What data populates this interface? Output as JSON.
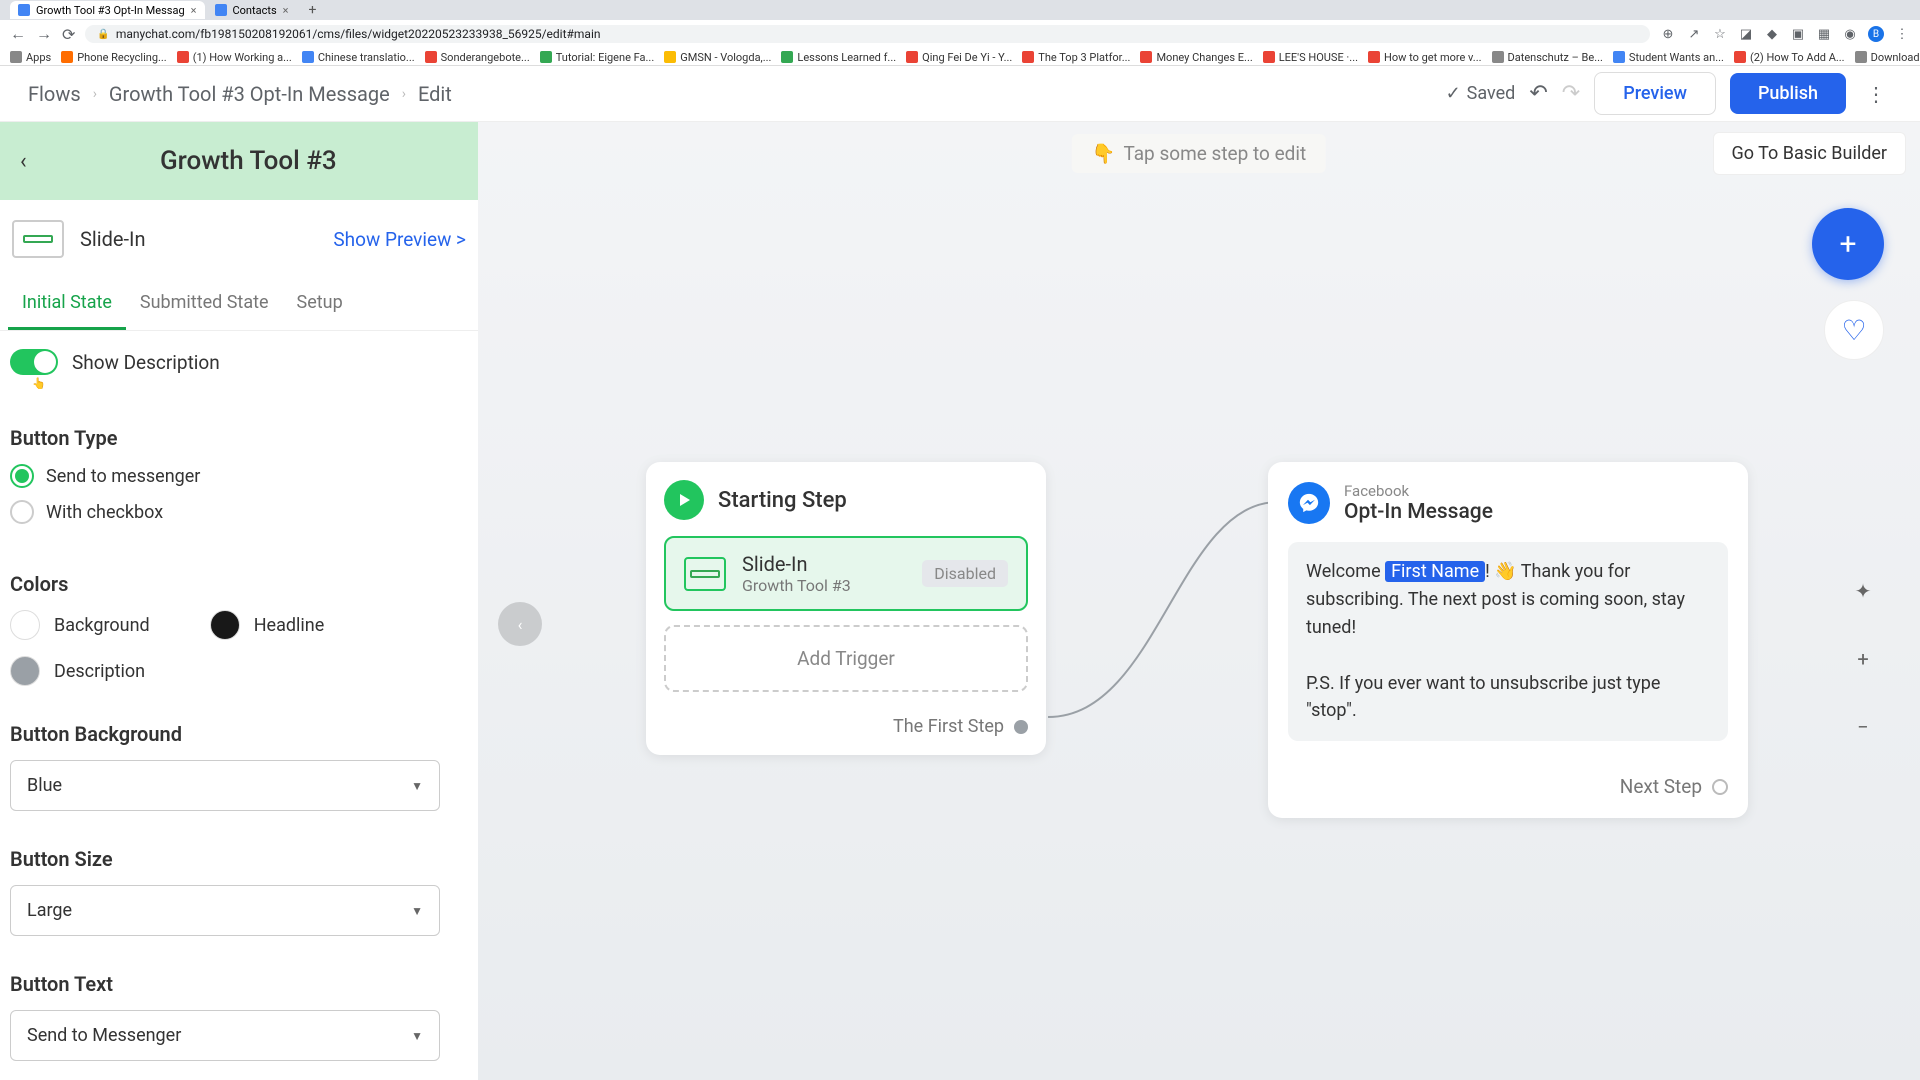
{
  "browser": {
    "tabs": [
      {
        "title": "Growth Tool #3 Opt-In Messag",
        "active": true
      },
      {
        "title": "Contacts",
        "active": false
      }
    ],
    "url": "manychat.com/fb198150208192061/cms/files/widget20220523233938_56925/edit#main",
    "bookmarks": [
      "Apps",
      "Phone Recycling...",
      "(1) How Working a...",
      "Chinese translatio...",
      "Sonderangebote...",
      "Tutorial: Eigene Fa...",
      "GMSN - Vologda,...",
      "Lessons Learned f...",
      "Qing Fei De Yi - Y...",
      "The Top 3 Platfor...",
      "Money Changes E...",
      "LEE'S HOUSE ·...",
      "How to get more v...",
      "Datenschutz – Be...",
      "Student Wants an...",
      "(2) How To Add A...",
      "Download - Cooki..."
    ]
  },
  "header": {
    "crumb1": "Flows",
    "crumb2": "Growth Tool #3 Opt-In Message",
    "crumb3": "Edit",
    "saved": "Saved",
    "preview": "Preview",
    "publish": "Publish"
  },
  "sidebar": {
    "title": "Growth Tool #3",
    "widget": "Slide-In",
    "show_preview": "Show Preview >",
    "tabs": {
      "initial": "Initial State",
      "submitted": "Submitted State",
      "setup": "Setup"
    },
    "show_desc": "Show Description",
    "button_type": {
      "head": "Button Type",
      "opt1": "Send to messenger",
      "opt2": "With checkbox"
    },
    "colors": {
      "head": "Colors",
      "bg": "Background",
      "headline": "Headline",
      "desc": "Description"
    },
    "btn_bg": {
      "head": "Button Background",
      "value": "Blue"
    },
    "btn_size": {
      "head": "Button Size",
      "value": "Large"
    },
    "btn_text": {
      "head": "Button Text",
      "value": "Send to Messenger"
    }
  },
  "canvas": {
    "hint": "Tap some step to edit",
    "go_basic": "Go To Basic Builder",
    "start": {
      "title": "Starting Step",
      "trigger_title": "Slide-In",
      "trigger_sub": "Growth Tool #3",
      "disabled": "Disabled",
      "add_trigger": "Add Trigger",
      "first_step": "The First Step"
    },
    "msg": {
      "sup": "Facebook",
      "title": "Opt-In Message",
      "body_pre": "Welcome ",
      "var": "First Name",
      "body_mid": "! 👋 Thank you for subscribing. The next post is coming soon, stay tuned!",
      "body_ps": "P.S. If you ever want to unsubscribe just type \"stop\".",
      "next": "Next Step"
    }
  }
}
